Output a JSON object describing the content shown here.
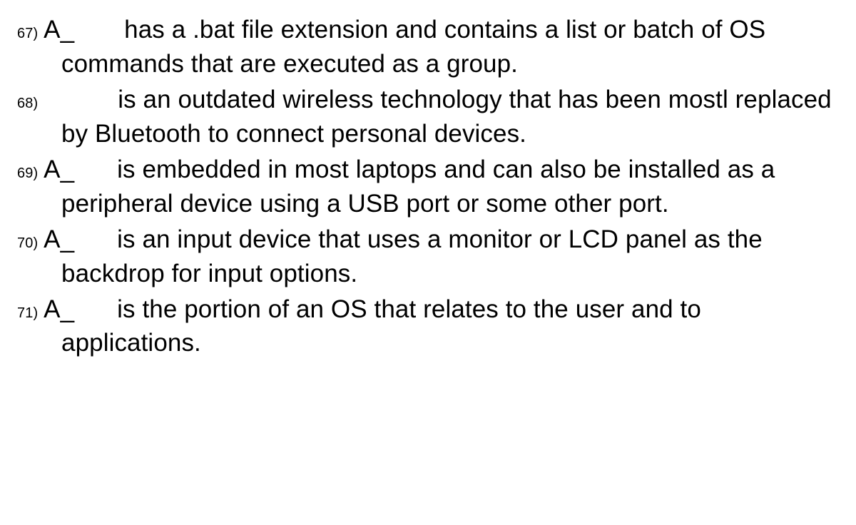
{
  "questions": [
    {
      "number": "67)",
      "lead": "A_",
      "text": "has a .bat file extension and contains a list or batch of OS commands that are executed as a group."
    },
    {
      "number": "68)",
      "lead": "",
      "text": "is an outdated wireless technology that has been mostl replaced by Bluetooth to connect personal devices."
    },
    {
      "number": "69)",
      "lead": "A_",
      "text": "is embedded in most laptops and can also be installed as a peripheral device using a USB port or some other port."
    },
    {
      "number": "70)",
      "lead": "A_",
      "text": "is an input device that uses a monitor or LCD panel as the backdrop for input options."
    },
    {
      "number": "71)",
      "lead": "A_",
      "text": "is the portion of an OS that relates to the user and to applications."
    }
  ]
}
